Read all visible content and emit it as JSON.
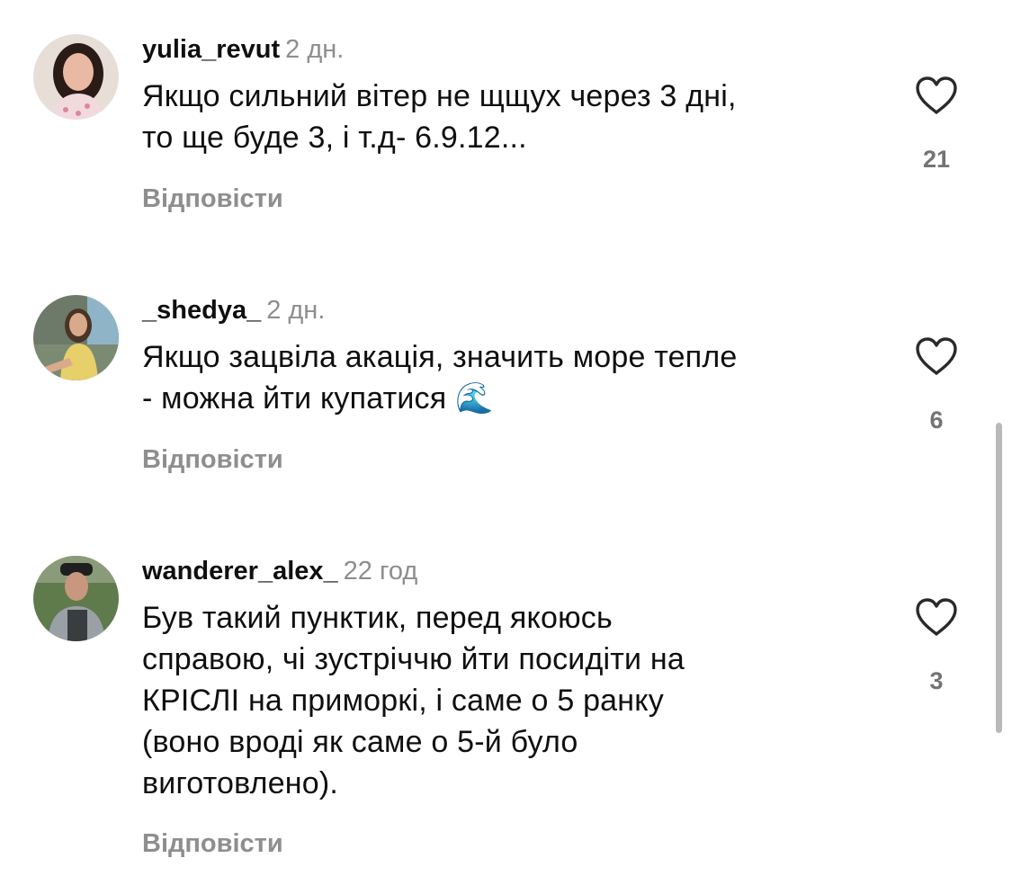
{
  "comments": [
    {
      "username": "yulia_revut",
      "time": "2 дн.",
      "text_lines": [
        "Якщо сильний вітер не щщух через 3 дні,",
        "то ще буде 3, і т.д- 6.9.12..."
      ],
      "reply_label": "Відповісти",
      "likes": "21",
      "avatar_colors": {
        "bg": "#e7ded8",
        "hair": "#2b1b16",
        "skin": "#e9b9a3",
        "top": "#f2d9de"
      }
    },
    {
      "username": "_shedya_",
      "time": "2 дн.",
      "text_lines": [
        "Якщо зацвіла акація, значить море тепле",
        "- можна йти купатися 🌊"
      ],
      "reply_label": "Відповісти",
      "likes": "6",
      "avatar_colors": {
        "bg": "#6d7a6a",
        "hair": "#4a3424",
        "skin": "#d9a98c",
        "top": "#e7cf6a"
      }
    },
    {
      "username": "wanderer_alex_",
      "time": "22 год",
      "text_lines": [
        "Був такий пунктик, перед якоюсь",
        "справою, чі зустріччю йти посидіти на",
        "КРІСЛІ на приморкі, і саме о 5 ранку",
        "(воно вроді як саме о 5-й було",
        "виготовлено)."
      ],
      "reply_label": "Відповісти",
      "likes": "3",
      "avatar_colors": {
        "bg": "#5f7a4b",
        "hair": "#1f1f1f",
        "skin": "#c8977d",
        "top": "#9aa1a6"
      }
    }
  ],
  "icons": {
    "like": "heart-outline-icon"
  },
  "colors": {
    "text": "#0f0f0f",
    "secondary": "#8e8e8e",
    "like_count": "#737373",
    "scrollbar": "#b9b9b9"
  }
}
